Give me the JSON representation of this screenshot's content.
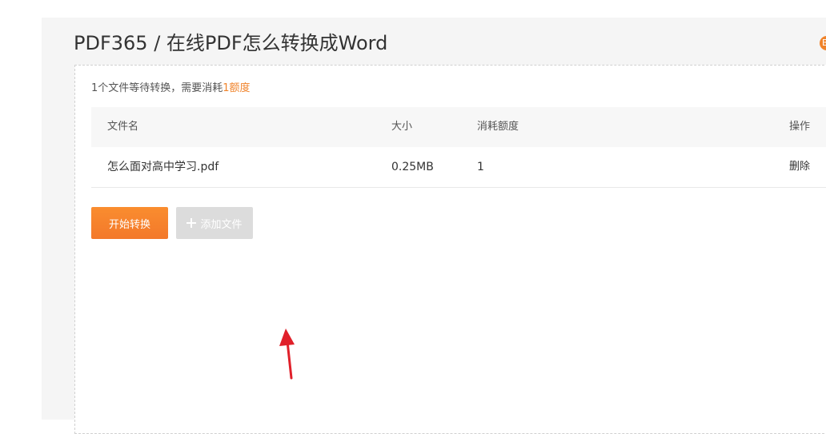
{
  "header": {
    "breadcrumb": "PDF365 / 在线PDF怎么转换成Word"
  },
  "summary": {
    "prefix": "1个文件等待转换，需要消耗",
    "credits": "1额度"
  },
  "table": {
    "columns": {
      "name": "文件名",
      "size": "大小",
      "cost": "消耗额度",
      "action": "操作"
    },
    "rows": [
      {
        "name": "怎么面对高中学习.pdf",
        "size": "0.25MB",
        "cost": "1",
        "action": "删除"
      }
    ]
  },
  "actions": {
    "start_label": "开始转换",
    "add_label": "添加文件"
  },
  "colors": {
    "accent": "#f0832a",
    "annotation_arrow": "#e0202a"
  },
  "icons": {
    "add": "plus-icon",
    "annotation": "red-arrow-icon"
  }
}
